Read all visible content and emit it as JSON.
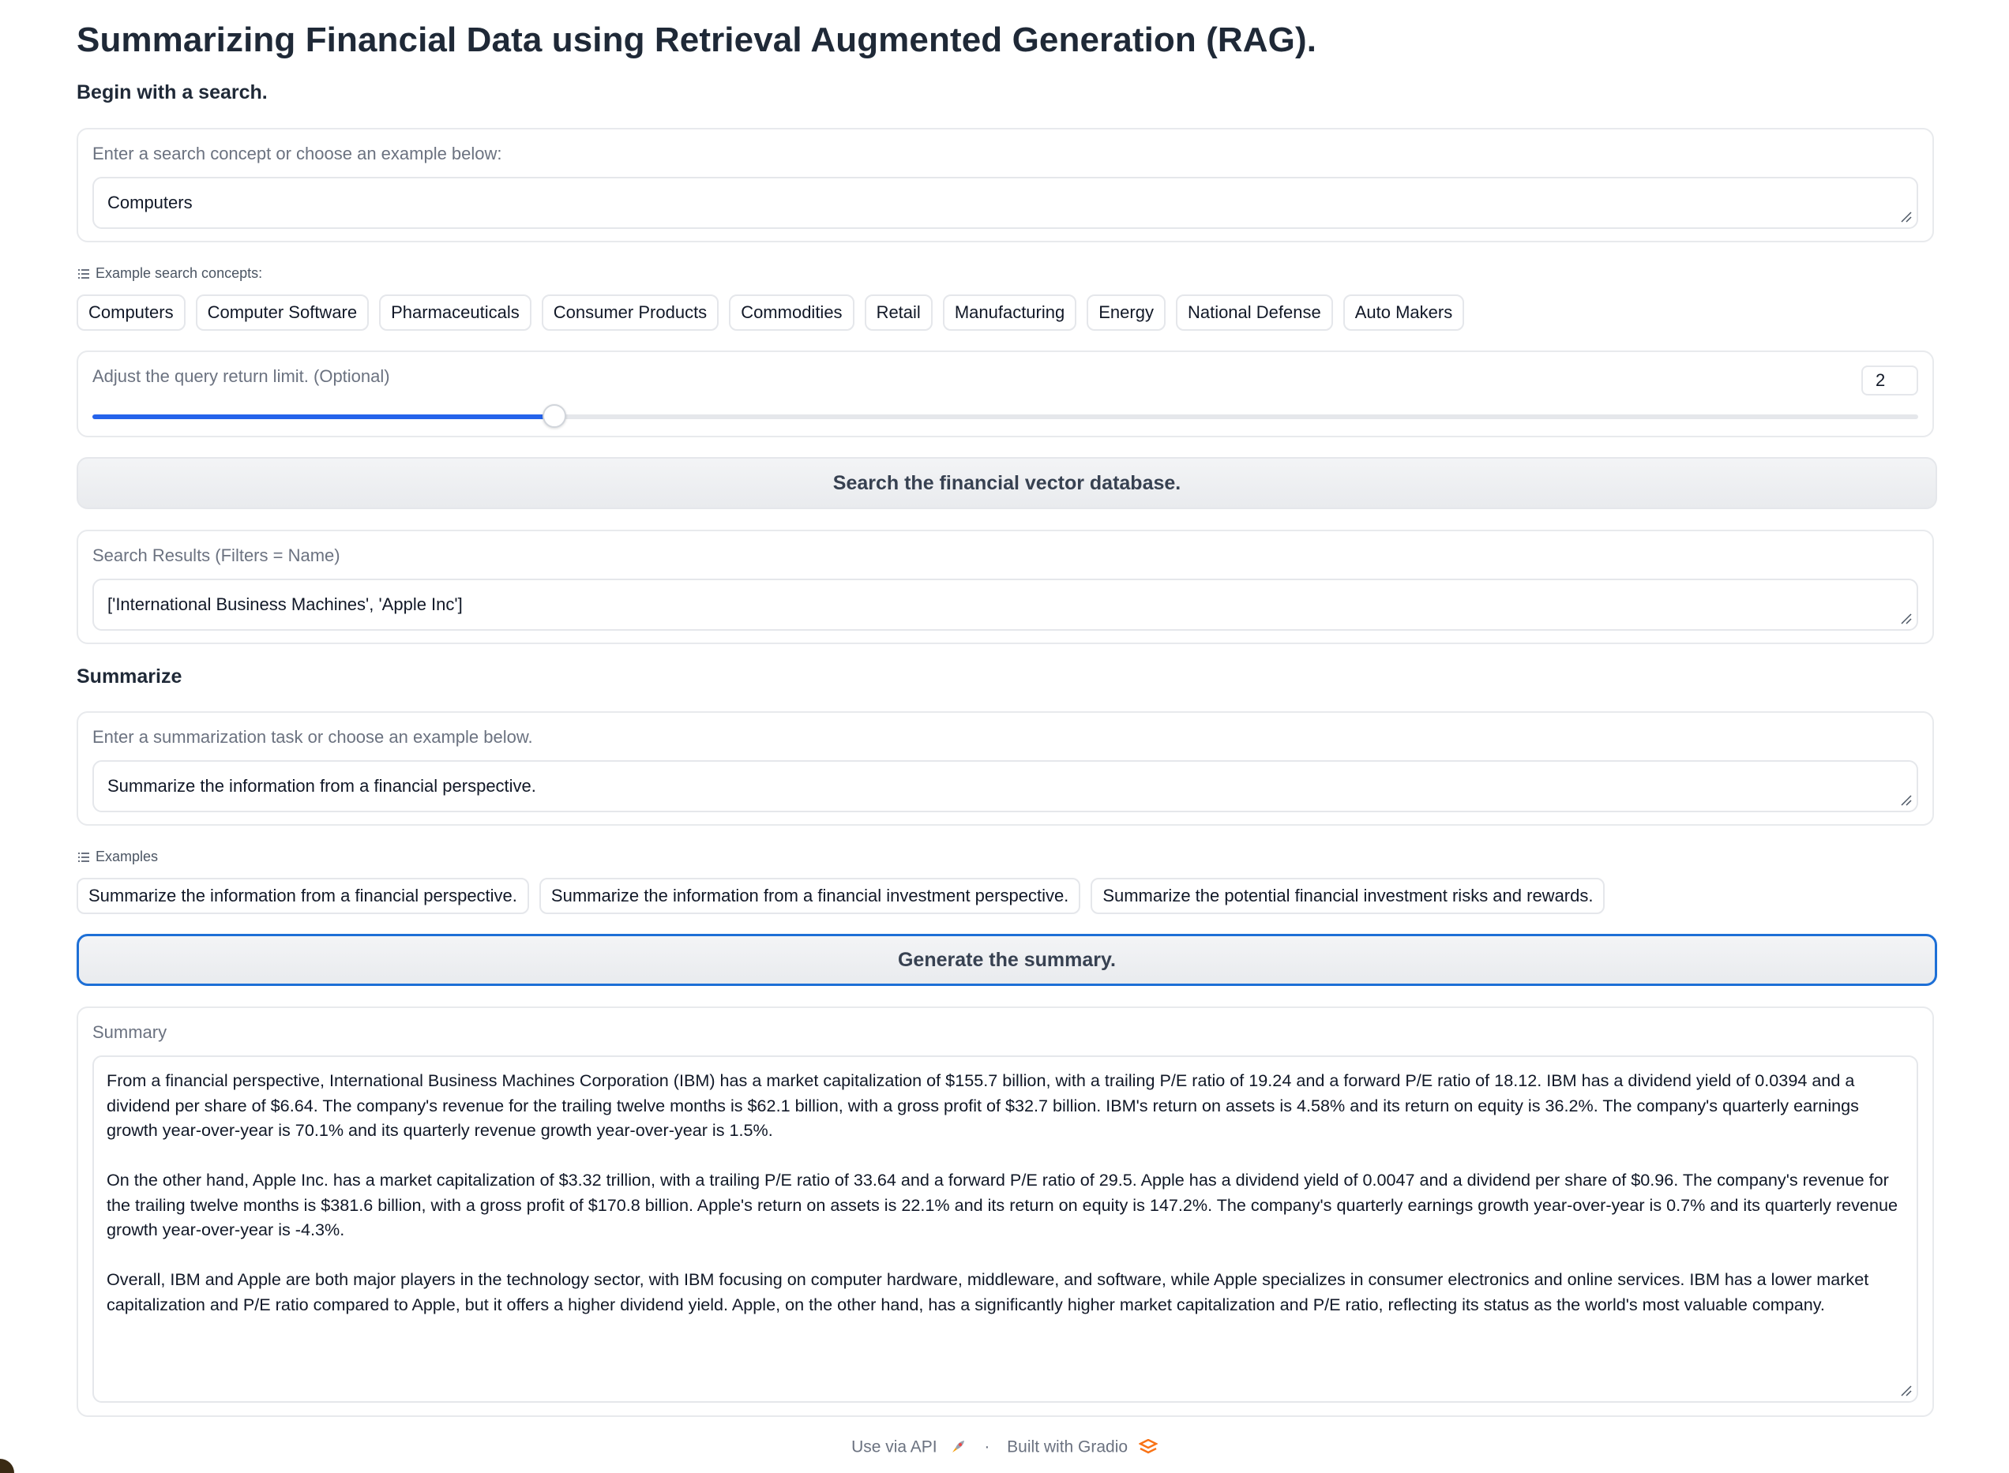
{
  "title": "Summarizing Financial Data using Retrieval Augmented Generation (RAG).",
  "search_section": {
    "heading": "Begin with a search.",
    "input_label": "Enter a search concept or choose an example below:",
    "input_value": "Computers",
    "examples_label": "Example search concepts:",
    "examples": [
      "Computers",
      "Computer Software",
      "Pharmaceuticals",
      "Consumer Products",
      "Commodities",
      "Retail",
      "Manufacturing",
      "Energy",
      "National Defense",
      "Auto Makers"
    ],
    "limit_label": "Adjust the query return limit. (Optional)",
    "limit_value": "2",
    "limit_fraction": 0.253,
    "search_button": "Search the financial vector database.",
    "results_label": "Search Results (Filters = Name)",
    "results_value": "['International Business Machines', 'Apple Inc']"
  },
  "summarize_section": {
    "heading": "Summarize",
    "input_label": "Enter a summarization task or choose an example below.",
    "input_value": "Summarize the information from a financial perspective.",
    "examples_label": "Examples",
    "examples": [
      "Summarize the information from a financial perspective.",
      "Summarize the information from a financial investment perspective.",
      "Summarize the potential financial investment risks and rewards."
    ],
    "generate_button": "Generate the summary.",
    "summary_label": "Summary",
    "summary_paragraphs": [
      "From a financial perspective, International Business Machines Corporation (IBM) has a market capitalization of $155.7 billion, with a trailing P/E ratio of 19.24 and a forward P/E ratio of 18.12. IBM has a dividend yield of 0.0394 and a dividend per share of $6.64. The company's revenue for the trailing twelve months is $62.1 billion, with a gross profit of $32.7 billion. IBM's return on assets is 4.58% and its return on equity is 36.2%. The company's quarterly earnings growth year-over-year is 70.1% and its quarterly revenue growth year-over-year is 1.5%.",
      "On the other hand, Apple Inc. has a market capitalization of $3.32 trillion, with a trailing P/E ratio of 33.64 and a forward P/E ratio of 29.5. Apple has a dividend yield of 0.0047 and a dividend per share of $0.96. The company's revenue for the trailing twelve months is $381.6 billion, with a gross profit of $170.8 billion. Apple's return on assets is 22.1% and its return on equity is 147.2%. The company's quarterly earnings growth year-over-year is 0.7% and its quarterly revenue growth year-over-year is -4.3%.",
      "Overall, IBM and Apple are both major players in the technology sector, with IBM focusing on computer hardware, middleware, and software, while Apple specializes in consumer electronics and online services. IBM has a lower market capitalization and P/E ratio compared to Apple, but it offers a higher dividend yield. Apple, on the other hand, has a significantly higher market capitalization and P/E ratio, reflecting its status as the world's most valuable company."
    ]
  },
  "footer": {
    "api_link": "Use via API",
    "api_icon": "rocket-icon",
    "separator": "·",
    "built_with": "Built with Gradio",
    "gradio_icon": "gradio-logo-icon"
  },
  "colors": {
    "accent": "#2563eb",
    "focus_border": "#1d6fd6",
    "gradio_orange": "#f97316"
  }
}
